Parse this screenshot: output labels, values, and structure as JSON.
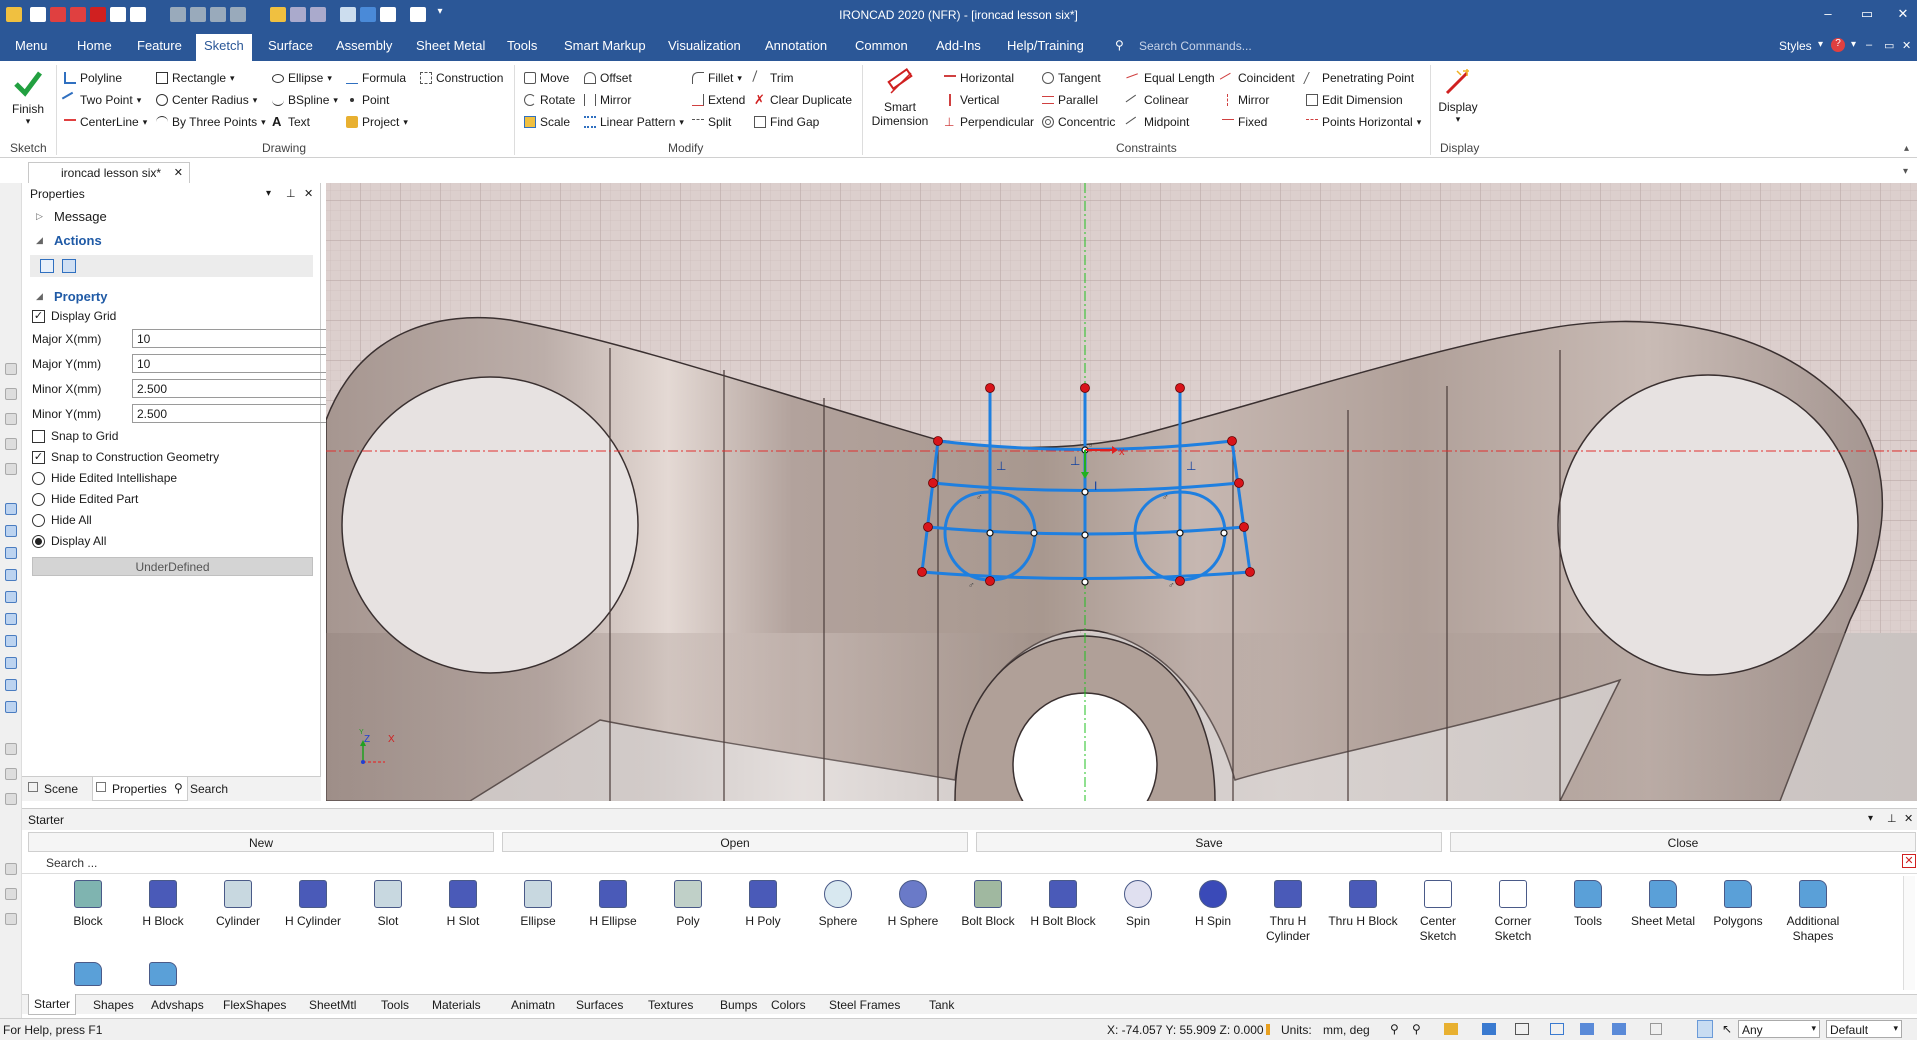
{
  "window": {
    "title": "IRONCAD 2020 (NFR) - [ironcad lesson six*]",
    "minimize": "–",
    "restore": "▭",
    "close": "✕"
  },
  "menu": {
    "items": [
      "Menu",
      "Home",
      "Feature",
      "Sketch",
      "Surface",
      "Assembly",
      "Sheet Metal",
      "Tools",
      "Smart Markup",
      "Visualization",
      "Annotation",
      "Common",
      "Add-Ins",
      "Help/Training"
    ],
    "active": "Sketch",
    "search_placeholder": "Search Commands...",
    "styles_label": "Styles"
  },
  "ribbon": {
    "sketch_group": {
      "finish": "Finish",
      "label": "Sketch"
    },
    "drawing_group": {
      "label": "Drawing",
      "col1": [
        "Polyline",
        "Two Point",
        "CenterLine"
      ],
      "col2": [
        "Rectangle",
        "Center Radius",
        "By Three Points"
      ],
      "col3": [
        "Ellipse",
        "BSpline",
        "Text"
      ],
      "col4": [
        "Formula",
        "Point",
        "Project"
      ],
      "col5": [
        "Construction"
      ]
    },
    "modify_group": {
      "label": "Modify",
      "col1": [
        "Move",
        "Rotate",
        "Scale"
      ],
      "col2": [
        "Offset",
        "Mirror",
        "Linear Pattern"
      ],
      "col3": [
        "Fillet",
        "Extend",
        "Split"
      ],
      "col4": [
        "Trim",
        "Clear Duplicate",
        "Find Gap"
      ]
    },
    "constraints_group": {
      "label": "Constraints",
      "smart_dimension_1": "Smart",
      "smart_dimension_2": "Dimension",
      "col1": [
        "Horizontal",
        "Vertical",
        "Perpendicular"
      ],
      "col2": [
        "Tangent",
        "Parallel",
        "Concentric"
      ],
      "col3": [
        "Equal Length",
        "Colinear",
        "Midpoint"
      ],
      "col4": [
        "Coincident",
        "Mirror",
        "Fixed"
      ],
      "col5": [
        "Penetrating Point",
        "Edit Dimension",
        "Points Horizontal"
      ]
    },
    "display_group": {
      "display": "Display",
      "label": "Display"
    }
  },
  "doc_tab": {
    "label": "ironcad lesson six*",
    "close": "✕"
  },
  "properties": {
    "title": "Properties",
    "message_label": "Message",
    "actions_label": "Actions",
    "property_label": "Property",
    "display_grid": "Display Grid",
    "major_x_label": "Major X(mm)",
    "major_x_value": "10",
    "major_y_label": "Major Y(mm)",
    "major_y_value": "10",
    "minor_x_label": "Minor X(mm)",
    "minor_x_value": "2.500",
    "minor_y_label": "Minor Y(mm)",
    "minor_y_value": "2.500",
    "snap_grid": "Snap to Grid",
    "snap_construction": "Snap to Construction Geometry",
    "hide_edited_intellishape": "Hide Edited Intellishape",
    "hide_edited_part": "Hide Edited Part",
    "hide_all": "Hide All",
    "display_all": "Display All",
    "status": "UnderDefined",
    "bottom_tabs": [
      "Scene",
      "Properties",
      "Search"
    ]
  },
  "viewport": {
    "axis_z": "Z",
    "axis_x": "X",
    "axis_y": "Y"
  },
  "starter": {
    "title": "Starter",
    "buttons": [
      "New",
      "Open",
      "Save",
      "Close"
    ],
    "search_placeholder": "Search ...",
    "items": [
      {
        "label": "Block",
        "icon": "block-icon"
      },
      {
        "label": "H Block",
        "icon": "h-block-icon"
      },
      {
        "label": "Cylinder",
        "icon": "cylinder-icon"
      },
      {
        "label": "H Cylinder",
        "icon": "h-cylinder-icon"
      },
      {
        "label": "Slot",
        "icon": "slot-icon"
      },
      {
        "label": "H Slot",
        "icon": "h-slot-icon"
      },
      {
        "label": "Ellipse",
        "icon": "ellipse-icon"
      },
      {
        "label": "H Ellipse",
        "icon": "h-ellipse-icon"
      },
      {
        "label": "Poly",
        "icon": "poly-icon"
      },
      {
        "label": "H Poly",
        "icon": "h-poly-icon"
      },
      {
        "label": "Sphere",
        "icon": "sphere-icon"
      },
      {
        "label": "H Sphere",
        "icon": "h-sphere-icon"
      },
      {
        "label": "Bolt Block",
        "icon": "bolt-block-icon"
      },
      {
        "label": "H Bolt Block",
        "icon": "h-bolt-block-icon"
      },
      {
        "label": "Spin",
        "icon": "spin-icon"
      },
      {
        "label": "H Spin",
        "icon": "h-spin-icon"
      },
      {
        "label": "Thru H Cylinder",
        "icon": "thru-h-cylinder-icon"
      },
      {
        "label": "Thru H Block",
        "icon": "thru-h-block-icon"
      },
      {
        "label": "Center Sketch",
        "icon": "center-sketch-icon"
      },
      {
        "label": "Corner Sketch",
        "icon": "corner-sketch-icon"
      },
      {
        "label": "Tools",
        "icon": "folder-icon"
      },
      {
        "label": "Sheet Metal",
        "icon": "folder-icon"
      },
      {
        "label": "Polygons",
        "icon": "folder-icon"
      },
      {
        "label": "Additional Shapes",
        "icon": "folder-icon"
      }
    ],
    "tabs": [
      "Starter",
      "Shapes",
      "Advshaps",
      "FlexShapes",
      "SheetMtl",
      "Tools",
      "Materials",
      "Animatn",
      "Surfaces",
      "Textures",
      "Bumps",
      "Colors",
      "Steel Frames",
      "Tank"
    ]
  },
  "status": {
    "help": "For Help, press F1",
    "coords": "X: -74.057 Y: 55.909 Z: 0.000",
    "units_label": "Units:",
    "units_value": "mm, deg",
    "filter": "Any",
    "style": "Default"
  },
  "colors": {
    "brand_blue": "#2b5797",
    "sketch_blue": "#1e7fe0",
    "point_red": "#d8141a",
    "part_surface": "#b6a8a2",
    "grid_bg": "#dccfcd"
  }
}
